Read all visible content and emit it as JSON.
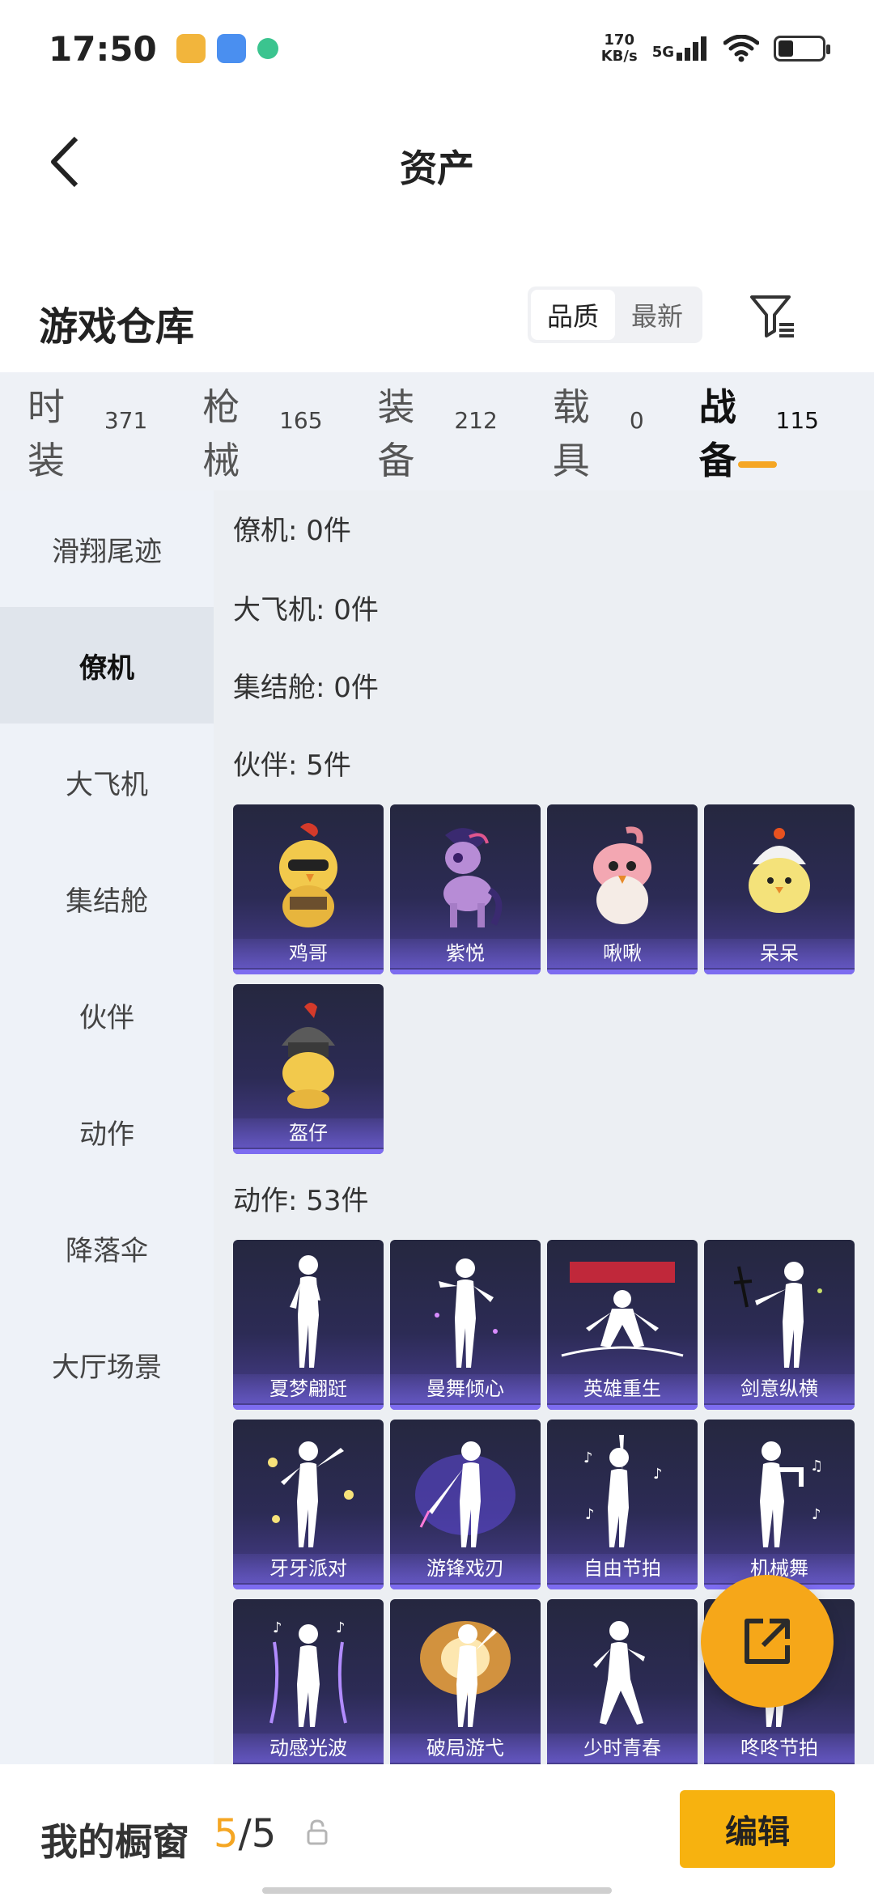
{
  "status_bar": {
    "time": "17:50",
    "speed_value": "170",
    "speed_unit": "KB/s",
    "network": "5G"
  },
  "header": {
    "title": "资产"
  },
  "warehouse": {
    "title": "游戏仓库",
    "sort_options": [
      "品质",
      "最新"
    ],
    "active_sort": "品质"
  },
  "tabs": [
    {
      "label": "时装",
      "count": "371"
    },
    {
      "label": "枪械",
      "count": "165"
    },
    {
      "label": "装备",
      "count": "212"
    },
    {
      "label": "载具",
      "count": "0"
    },
    {
      "label": "战备",
      "count": "115"
    }
  ],
  "active_tab": "战备",
  "sidebar": {
    "items": [
      "滑翔尾迹",
      "僚机",
      "大飞机",
      "集结舱",
      "伙伴",
      "动作",
      "降落伞",
      "大厅场景"
    ],
    "selected": "僚机"
  },
  "sections": {
    "wingman": "僚机: 0件",
    "big_plane": "大飞机: 0件",
    "assembly_pod": "集结舱: 0件",
    "companion": "伙伴: 5件",
    "emote": "动作: 53件"
  },
  "companions": [
    "鸡哥",
    "紫悦",
    "啾啾",
    "呆呆",
    "盔仔"
  ],
  "emotes": [
    "夏梦翩跹",
    "曼舞倾心",
    "英雄重生",
    "剑意纵横",
    "牙牙派对",
    "游锋戏刃",
    "自由节拍",
    "机械舞",
    "动感光波",
    "破局游弋",
    "少时青春",
    "咚咚节拍"
  ],
  "bottom": {
    "showcase_label": "我的橱窗",
    "showcase_current": "5",
    "showcase_sep": "/",
    "showcase_total": "5",
    "edit_label": "编辑"
  },
  "colors": {
    "accent": "#f5a623",
    "edit_button": "#f7b20f",
    "card_bg": "#2c2b55",
    "card_bar": "#7d6cf0"
  }
}
